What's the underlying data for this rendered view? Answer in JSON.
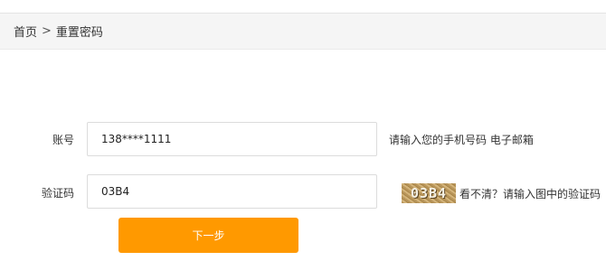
{
  "breadcrumb": {
    "home": "首页",
    "separator": ">",
    "current": "重置密码"
  },
  "form": {
    "account": {
      "label": "账号",
      "value": "138****1111",
      "hint": "请输入您的手机号码 电子邮箱"
    },
    "captcha": {
      "label": "验证码",
      "value": "03B4",
      "image_text": "03B4",
      "refresh_text": "看不清？",
      "hint": "请输入图中的验证码"
    },
    "submit_label": "下一步"
  },
  "colors": {
    "accent": "#ff9900",
    "breadcrumb_bg": "#f5f5f5"
  }
}
